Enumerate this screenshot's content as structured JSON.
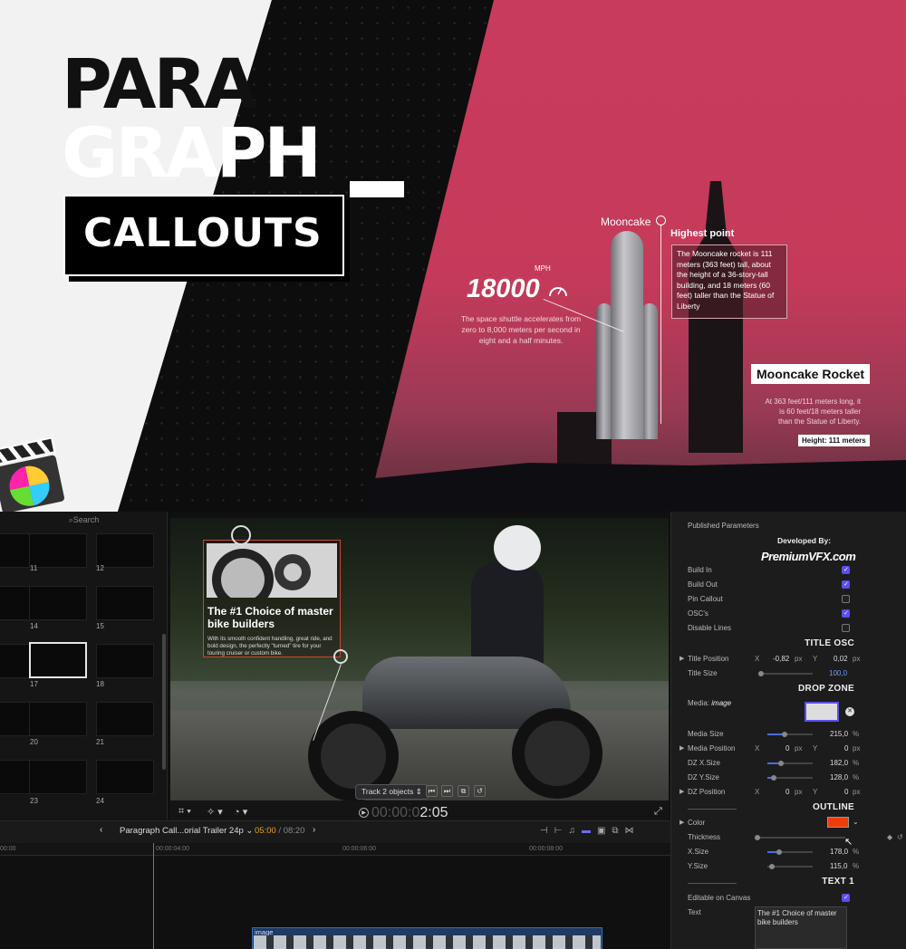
{
  "hero": {
    "title_line1": "PARA",
    "title_line2": "GRAPH",
    "subtitle": "CALLOUTS",
    "speed_value": "18000",
    "speed_unit": "MPH",
    "speed_desc": "The space shuttle accelerates from zero to 8,000 meters per second in eight and a half minutes.",
    "mooncake_label": "Mooncake",
    "highest_point_label": "Highest point",
    "highest_point_text": "The Mooncake rocket is 111 meters (363 feet) tall, about the height of a 36-story-tall building, and 18 meters (60 feet) taller than the Statue of Liberty",
    "rocket_label": "Mooncake Rocket",
    "rocket_desc": "At 363 feet/111 meters long, it is 60 feet/18 meters taller than the Statue of Liberty.",
    "height_badge": "Height: 111 meters"
  },
  "browser": {
    "search_label": "Search",
    "thumb_numbers": [
      "11",
      "12",
      "14",
      "15",
      "17",
      "18",
      "20",
      "21",
      "23",
      "24"
    ]
  },
  "viewer": {
    "callout_title": "The #1 Choice of master bike builders",
    "callout_desc": "With its smooth confident handling, great ride, and bold design, the perfectly \"turned\" tire for your touring cruiser or custom bike.",
    "track_pill": "Track 2 objects",
    "timecode_dim": "00:00:0",
    "timecode_bright": "2:05"
  },
  "timeline": {
    "project": "Paragraph Call...orial Trailer 24p",
    "time_current": "05:00",
    "time_total": "08:20",
    "ticks": [
      "00:00",
      "00:00:04:00",
      "00:00:06:00",
      "00:00:08:00"
    ],
    "clip_label": "image"
  },
  "inspector": {
    "header": "Published Parameters",
    "developed_by": "Developed By:",
    "brand": "PremiumVFX.com",
    "build_in": "Build In",
    "build_out": "Build Out",
    "pin_callout": "Pin Callout",
    "oscs": "OSC's",
    "disable_lines": "Disable Lines",
    "sec_title_osc": "TITLE OSC",
    "title_position": "Title Position",
    "title_pos_x": "-0,82",
    "title_pos_y": "0,02",
    "title_size": "Title Size",
    "title_size_val": "100,0",
    "sec_drop_zone": "DROP ZONE",
    "media_label": "Media:",
    "media_value": "image",
    "media_size": "Media Size",
    "media_size_val": "215,0",
    "media_position": "Media Position",
    "media_pos_x": "0",
    "media_pos_y": "0",
    "dz_x_size": "DZ X.Size",
    "dz_x_size_val": "182,0",
    "dz_y_size": "DZ Y.Size",
    "dz_y_size_val": "128,0",
    "dz_position": "DZ Position",
    "dz_pos_x": "0",
    "dz_pos_y": "0",
    "sec_outline": "OUTLINE",
    "color": "Color",
    "color_value": "#f03d07",
    "thickness": "Thickness",
    "x_size": "X.Size",
    "x_size_val": "178,0",
    "y_size": "Y.Size",
    "y_size_val": "115,0",
    "sec_text1": "TEXT 1",
    "editable": "Editable on Canvas",
    "text_label": "Text",
    "text_value": "The #1 Choice of master bike builders",
    "unit_px": "px",
    "unit_pct": "%",
    "axis_x": "X",
    "axis_y": "Y"
  }
}
